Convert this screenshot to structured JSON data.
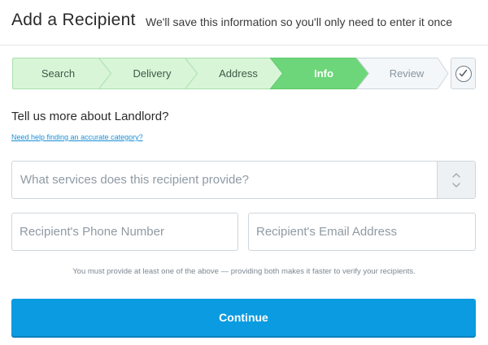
{
  "header": {
    "title": "Add a Recipient",
    "subtitle": "We'll save this information so you'll only need to enter it once"
  },
  "stepper": {
    "steps": [
      {
        "label": "Search",
        "state": "done"
      },
      {
        "label": "Delivery",
        "state": "done"
      },
      {
        "label": "Address",
        "state": "done"
      },
      {
        "label": "Info",
        "state": "active"
      },
      {
        "label": "Review",
        "state": "todo"
      }
    ],
    "final_icon": "check-circle-icon",
    "colors": {
      "done": "#d8f5d8",
      "done_border": "#a9e0ab",
      "active": "#6ed67a",
      "todo": "#f3f7f9",
      "todo_border": "#cfd6dc"
    }
  },
  "form": {
    "question": "Tell us more about Landlord?",
    "help_link": "Need help finding an accurate category?",
    "services_select": {
      "placeholder": "What services does this recipient provide?"
    },
    "phone": {
      "placeholder": "Recipient's Phone Number",
      "value": ""
    },
    "email": {
      "placeholder": "Recipient's Email Address",
      "value": ""
    },
    "note": "You must provide at least one of the above — providing both makes it faster to verify your recipients."
  },
  "continue_button": {
    "label": "Continue",
    "color": "#0a9be0"
  }
}
